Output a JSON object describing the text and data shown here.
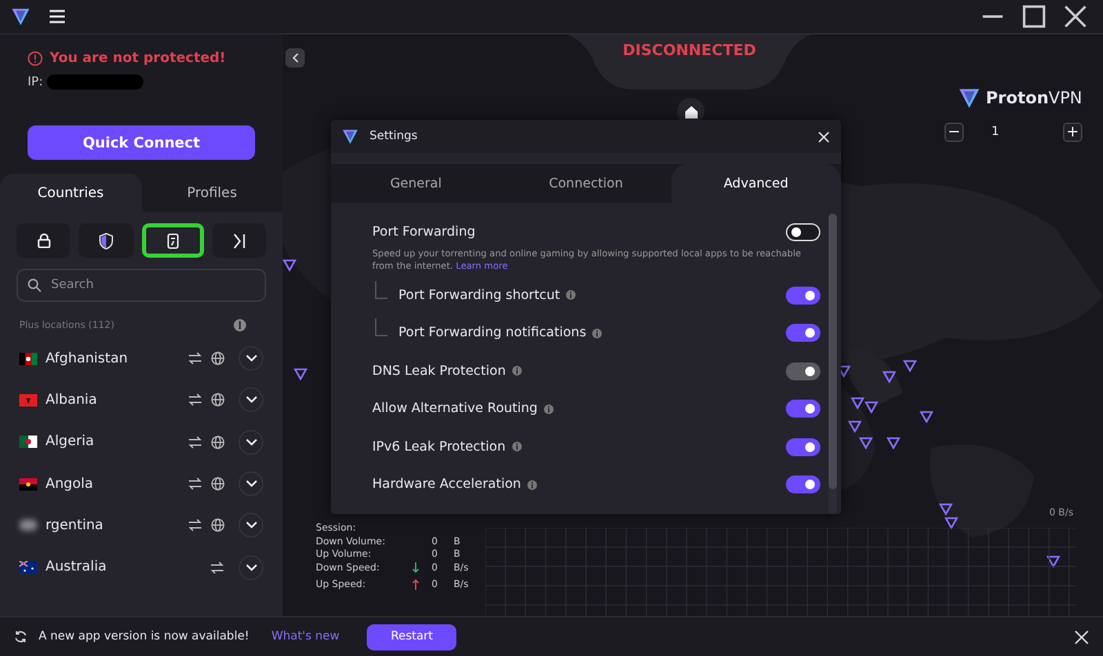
{
  "status": {
    "message": "You are not protected!",
    "ip_label": "IP:"
  },
  "quick_connect": "Quick Connect",
  "panel_tabs": [
    {
      "label": "Countries",
      "selected": true
    },
    {
      "label": "Profiles",
      "selected": false
    }
  ],
  "filters": [
    {
      "kind": "lock",
      "highlighted": false
    },
    {
      "kind": "shield",
      "highlighted": false
    },
    {
      "kind": "p2p",
      "highlighted": true
    },
    {
      "kind": "tor",
      "highlighted": false
    }
  ],
  "search": {
    "placeholder": "Search"
  },
  "list_heading": "Plus locations (112)",
  "countries": [
    {
      "name": "Afghanistan",
      "kind": "af",
      "p2p": true,
      "tor": true
    },
    {
      "name": "Albania",
      "kind": "al",
      "p2p": true,
      "tor": true
    },
    {
      "name": "Algeria",
      "kind": "dz",
      "p2p": true,
      "tor": true
    },
    {
      "name": "Angola",
      "kind": "ao",
      "p2p": true,
      "tor": true
    },
    {
      "name": "rgentina",
      "kind": "blur",
      "p2p": true,
      "tor": true
    },
    {
      "name": "Australia",
      "kind": "au",
      "p2p": true,
      "tor": false
    }
  ],
  "connection_state": "DISCONNECTED",
  "brand": {
    "name": "Proton",
    "suffix": "VPN"
  },
  "zoom": {
    "minus": "−",
    "level": "1",
    "plus": "+"
  },
  "settings": {
    "title": "Settings",
    "tabs": [
      {
        "label": "General",
        "selected": false
      },
      {
        "label": "Connection",
        "selected": false
      },
      {
        "label": "Advanced",
        "selected": true
      }
    ],
    "options": [
      {
        "label": "Port Forwarding",
        "on": false,
        "disabled": false,
        "info": false,
        "description": "Speed up your torrenting and online gaming by allowing supported local apps to be reachable from the internet.",
        "link": "Learn more",
        "children": [
          {
            "label": "Port Forwarding shortcut",
            "on": true,
            "disabled": false,
            "info": true
          },
          {
            "label": "Port Forwarding notifications",
            "on": true,
            "disabled": false,
            "info": true
          }
        ]
      },
      {
        "label": "DNS Leak Protection",
        "on": true,
        "disabled": true,
        "info": true
      },
      {
        "label": "Allow Alternative Routing",
        "on": true,
        "disabled": false,
        "info": true
      },
      {
        "label": "IPv6 Leak Protection",
        "on": true,
        "disabled": false,
        "info": true
      },
      {
        "label": "Hardware Acceleration",
        "on": true,
        "disabled": false,
        "info": true
      }
    ]
  },
  "stats": [
    {
      "label": "Session:",
      "kind": "plain"
    },
    {
      "label": "Down Volume:",
      "kind": "plain",
      "value": "0",
      "unit": "B"
    },
    {
      "label": "Up Volume:",
      "kind": "plain",
      "value": "0",
      "unit": "B"
    },
    {
      "label": "Down Speed:",
      "kind": "down",
      "value": "0",
      "unit": "B/s"
    },
    {
      "label": "Up Speed:",
      "kind": "up",
      "value": "0",
      "unit": "B/s"
    }
  ],
  "graph_max": "0 B/s",
  "update_bar": {
    "message": "A new app version is now available!",
    "link": "What's new",
    "button": "Restart"
  }
}
